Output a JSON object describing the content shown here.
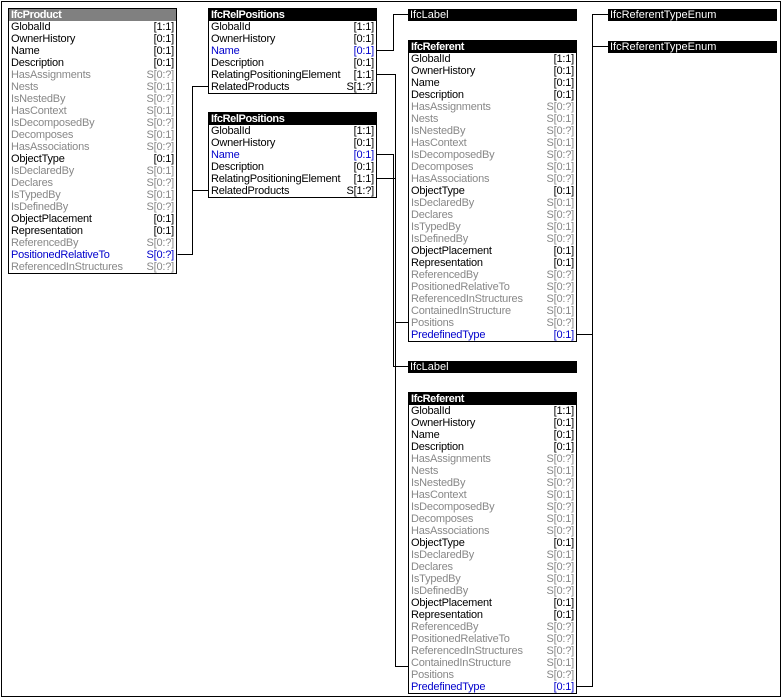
{
  "entities": {
    "ifc_product": {
      "title": "IfcProduct",
      "header_color": "#808080",
      "attributes": [
        {
          "name": "GlobalId",
          "card": "[1:1]",
          "kind": "req"
        },
        {
          "name": "OwnerHistory",
          "card": "[0:1]",
          "kind": "req"
        },
        {
          "name": "Name",
          "card": "[0:1]",
          "kind": "req"
        },
        {
          "name": "Description",
          "card": "[0:1]",
          "kind": "req"
        },
        {
          "name": "HasAssignments",
          "card": "S[0:?]",
          "kind": "inv"
        },
        {
          "name": "Nests",
          "card": "S[0:1]",
          "kind": "inv"
        },
        {
          "name": "IsNestedBy",
          "card": "S[0:?]",
          "kind": "inv"
        },
        {
          "name": "HasContext",
          "card": "S[0:1]",
          "kind": "inv"
        },
        {
          "name": "IsDecomposedBy",
          "card": "S[0:?]",
          "kind": "inv"
        },
        {
          "name": "Decomposes",
          "card": "S[0:1]",
          "kind": "inv"
        },
        {
          "name": "HasAssociations",
          "card": "S[0:?]",
          "kind": "inv"
        },
        {
          "name": "ObjectType",
          "card": "[0:1]",
          "kind": "req"
        },
        {
          "name": "IsDeclaredBy",
          "card": "S[0:1]",
          "kind": "inv"
        },
        {
          "name": "Declares",
          "card": "S[0:?]",
          "kind": "inv"
        },
        {
          "name": "IsTypedBy",
          "card": "S[0:1]",
          "kind": "inv"
        },
        {
          "name": "IsDefinedBy",
          "card": "S[0:?]",
          "kind": "inv"
        },
        {
          "name": "ObjectPlacement",
          "card": "[0:1]",
          "kind": "req"
        },
        {
          "name": "Representation",
          "card": "[0:1]",
          "kind": "req"
        },
        {
          "name": "ReferencedBy",
          "card": "S[0:?]",
          "kind": "inv"
        },
        {
          "name": "PositionedRelativeTo",
          "card": "S[0:?]",
          "kind": "link"
        },
        {
          "name": "ReferencedInStructures",
          "card": "S[0:?]",
          "kind": "inv"
        }
      ]
    },
    "ifc_rel_positions_1": {
      "title": "IfcRelPositions",
      "attributes": [
        {
          "name": "GlobalId",
          "card": "[1:1]",
          "kind": "req"
        },
        {
          "name": "OwnerHistory",
          "card": "[0:1]",
          "kind": "req"
        },
        {
          "name": "Name",
          "card": "[0:1]",
          "kind": "link"
        },
        {
          "name": "Description",
          "card": "[0:1]",
          "kind": "req"
        },
        {
          "name": "RelatingPositioningElement",
          "card": "[1:1]",
          "kind": "req"
        },
        {
          "name": "RelatedProducts",
          "card": "S[1:?]",
          "kind": "req"
        }
      ]
    },
    "ifc_rel_positions_2": {
      "title": "IfcRelPositions",
      "attributes": [
        {
          "name": "GlobalId",
          "card": "[1:1]",
          "kind": "req"
        },
        {
          "name": "OwnerHistory",
          "card": "[0:1]",
          "kind": "req"
        },
        {
          "name": "Name",
          "card": "[0:1]",
          "kind": "link"
        },
        {
          "name": "Description",
          "card": "[0:1]",
          "kind": "req"
        },
        {
          "name": "RelatingPositioningElement",
          "card": "[1:1]",
          "kind": "req"
        },
        {
          "name": "RelatedProducts",
          "card": "S[1:?]",
          "kind": "req"
        }
      ]
    },
    "ifc_referent_1": {
      "title": "IfcReferent",
      "attributes": [
        {
          "name": "GlobalId",
          "card": "[1:1]",
          "kind": "req"
        },
        {
          "name": "OwnerHistory",
          "card": "[0:1]",
          "kind": "req"
        },
        {
          "name": "Name",
          "card": "[0:1]",
          "kind": "req"
        },
        {
          "name": "Description",
          "card": "[0:1]",
          "kind": "req"
        },
        {
          "name": "HasAssignments",
          "card": "S[0:?]",
          "kind": "inv"
        },
        {
          "name": "Nests",
          "card": "S[0:1]",
          "kind": "inv"
        },
        {
          "name": "IsNestedBy",
          "card": "S[0:?]",
          "kind": "inv"
        },
        {
          "name": "HasContext",
          "card": "S[0:1]",
          "kind": "inv"
        },
        {
          "name": "IsDecomposedBy",
          "card": "S[0:?]",
          "kind": "inv"
        },
        {
          "name": "Decomposes",
          "card": "S[0:1]",
          "kind": "inv"
        },
        {
          "name": "HasAssociations",
          "card": "S[0:?]",
          "kind": "inv"
        },
        {
          "name": "ObjectType",
          "card": "[0:1]",
          "kind": "req"
        },
        {
          "name": "IsDeclaredBy",
          "card": "S[0:1]",
          "kind": "inv"
        },
        {
          "name": "Declares",
          "card": "S[0:?]",
          "kind": "inv"
        },
        {
          "name": "IsTypedBy",
          "card": "S[0:1]",
          "kind": "inv"
        },
        {
          "name": "IsDefinedBy",
          "card": "S[0:?]",
          "kind": "inv"
        },
        {
          "name": "ObjectPlacement",
          "card": "[0:1]",
          "kind": "req"
        },
        {
          "name": "Representation",
          "card": "[0:1]",
          "kind": "req"
        },
        {
          "name": "ReferencedBy",
          "card": "S[0:?]",
          "kind": "inv"
        },
        {
          "name": "PositionedRelativeTo",
          "card": "S[0:?]",
          "kind": "inv"
        },
        {
          "name": "ReferencedInStructures",
          "card": "S[0:?]",
          "kind": "inv"
        },
        {
          "name": "ContainedInStructure",
          "card": "S[0:1]",
          "kind": "inv"
        },
        {
          "name": "Positions",
          "card": "S[0:?]",
          "kind": "inv"
        },
        {
          "name": "PredefinedType",
          "card": "[0:1]",
          "kind": "link"
        }
      ]
    },
    "ifc_referent_2": {
      "title": "IfcReferent",
      "attributes": [
        {
          "name": "GlobalId",
          "card": "[1:1]",
          "kind": "req"
        },
        {
          "name": "OwnerHistory",
          "card": "[0:1]",
          "kind": "req"
        },
        {
          "name": "Name",
          "card": "[0:1]",
          "kind": "req"
        },
        {
          "name": "Description",
          "card": "[0:1]",
          "kind": "req"
        },
        {
          "name": "HasAssignments",
          "card": "S[0:?]",
          "kind": "inv"
        },
        {
          "name": "Nests",
          "card": "S[0:1]",
          "kind": "inv"
        },
        {
          "name": "IsNestedBy",
          "card": "S[0:?]",
          "kind": "inv"
        },
        {
          "name": "HasContext",
          "card": "S[0:1]",
          "kind": "inv"
        },
        {
          "name": "IsDecomposedBy",
          "card": "S[0:?]",
          "kind": "inv"
        },
        {
          "name": "Decomposes",
          "card": "S[0:1]",
          "kind": "inv"
        },
        {
          "name": "HasAssociations",
          "card": "S[0:?]",
          "kind": "inv"
        },
        {
          "name": "ObjectType",
          "card": "[0:1]",
          "kind": "req"
        },
        {
          "name": "IsDeclaredBy",
          "card": "S[0:1]",
          "kind": "inv"
        },
        {
          "name": "Declares",
          "card": "S[0:?]",
          "kind": "inv"
        },
        {
          "name": "IsTypedBy",
          "card": "S[0:1]",
          "kind": "inv"
        },
        {
          "name": "IsDefinedBy",
          "card": "S[0:?]",
          "kind": "inv"
        },
        {
          "name": "ObjectPlacement",
          "card": "[0:1]",
          "kind": "req"
        },
        {
          "name": "Representation",
          "card": "[0:1]",
          "kind": "req"
        },
        {
          "name": "ReferencedBy",
          "card": "S[0:?]",
          "kind": "inv"
        },
        {
          "name": "PositionedRelativeTo",
          "card": "S[0:?]",
          "kind": "inv"
        },
        {
          "name": "ReferencedInStructures",
          "card": "S[0:?]",
          "kind": "inv"
        },
        {
          "name": "ContainedInStructure",
          "card": "S[0:1]",
          "kind": "inv"
        },
        {
          "name": "Positions",
          "card": "S[0:?]",
          "kind": "inv"
        },
        {
          "name": "PredefinedType",
          "card": "[0:1]",
          "kind": "link"
        }
      ]
    }
  },
  "type_labels": {
    "ifc_label_1": "IfcLabel",
    "ifc_label_2": "IfcLabel",
    "ifc_referent_type_enum_1": "IfcReferentTypeEnum",
    "ifc_referent_type_enum_2": "IfcReferentTypeEnum"
  },
  "colors": {
    "required": "#000000",
    "inverse": "#888888",
    "link": "#0000cc",
    "header": "#000000",
    "header_root": "#808080"
  }
}
